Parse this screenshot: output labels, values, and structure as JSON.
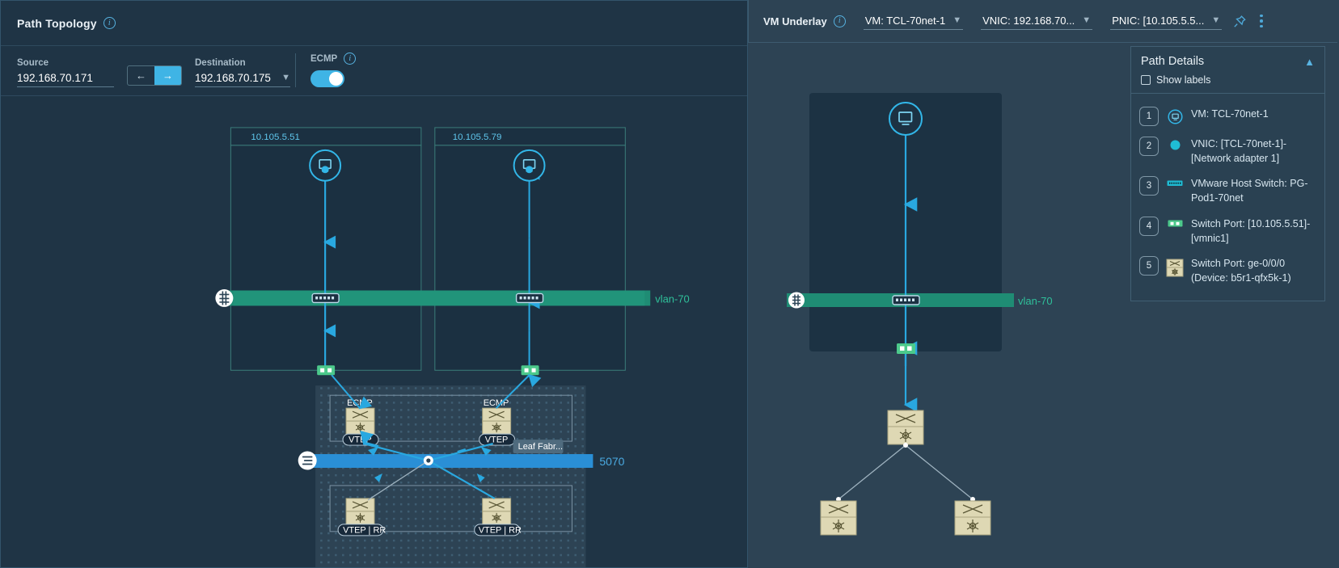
{
  "left_panel": {
    "title": "Path Topology",
    "info_icon": "info-icon",
    "source": {
      "label": "Source",
      "value": "192.168.70.171"
    },
    "direction": {
      "back_icon": "arrow-left-icon",
      "forward_icon": "arrow-right-icon"
    },
    "destination": {
      "label": "Destination",
      "value": "192.168.70.175",
      "caret_icon": "chevron-down-icon"
    },
    "ecmp": {
      "label": "ECMP",
      "enabled": true
    },
    "topology": {
      "hosts": [
        {
          "ip": "10.105.5.51",
          "vm_icon": "vm-monitor-icon",
          "nic_icon": "nic-port-icon"
        },
        {
          "ip": "10.105.5.79",
          "vm_icon": "vm-monitor-icon",
          "nic_icon": "nic-port-icon"
        }
      ],
      "vlan_band": {
        "label": "vlan-70",
        "color": "#1f8c74",
        "badge_icon": "vlan-badge-icon"
      },
      "vni_band": {
        "label": "5070",
        "color": "#2a8fd6",
        "badge_icon": "vni-badge-icon"
      },
      "leaf_group": {
        "tooltip": "Leaf Fabr...",
        "nodes": [
          {
            "top_label": "ECMP",
            "bottom_label": "VTEP",
            "switch_icon": "switch-icon"
          },
          {
            "top_label": "ECMP",
            "bottom_label": "VTEP",
            "switch_icon": "switch-icon"
          }
        ]
      },
      "spine_group": {
        "nodes": [
          {
            "bottom_label": "VTEP | RR",
            "switch_icon": "switch-icon"
          },
          {
            "bottom_label": "VTEP | RR",
            "switch_icon": "switch-icon"
          }
        ]
      }
    }
  },
  "right_panel": {
    "title": "VM Underlay",
    "info_icon": "info-icon",
    "selectors": [
      {
        "name": "vm-selector",
        "value": "VM: TCL-70net-1",
        "caret_icon": "chevron-down-icon"
      },
      {
        "name": "vnic-selector",
        "value": "VNIC: 192.168.70...",
        "caret_icon": "chevron-down-icon"
      },
      {
        "name": "pnic-selector",
        "value": "PNIC: [10.105.5.5...",
        "caret_icon": "chevron-down-icon"
      }
    ],
    "pin_icon": "pin-icon",
    "menu_icon": "kebab-menu-icon",
    "path_details": {
      "title": "Path Details",
      "collapse_icon": "chevron-up-icon",
      "show_labels": {
        "label": "Show labels",
        "checked": false
      },
      "items": [
        {
          "num": "1",
          "icon": "vm-circle-icon",
          "text": "VM: TCL-70net-1"
        },
        {
          "num": "2",
          "icon": "vnic-dot-icon",
          "text": "VNIC: [TCL-70net-1]-[Network adapter 1]"
        },
        {
          "num": "3",
          "icon": "host-switch-icon",
          "text": "VMware Host Switch: PG-Pod1-70net"
        },
        {
          "num": "4",
          "icon": "switch-port-icon",
          "text": "Switch Port: [10.105.5.51]-[vmnic1]"
        },
        {
          "num": "5",
          "icon": "physical-switch-icon",
          "text": "Switch Port: ge-0/0/0 (Device: b5r1-qfx5k-1)"
        }
      ]
    },
    "topology": {
      "vm_icon": "vm-monitor-icon",
      "nic_icon": "nic-port-icon",
      "vlan_band": {
        "label": "vlan-70",
        "color": "#1f8c74",
        "badge_icon": "vlan-badge-icon"
      },
      "switches": [
        {
          "name": "leaf-switch",
          "switch_icon": "switch-icon"
        },
        {
          "name": "spine-switch-left",
          "switch_icon": "switch-icon"
        },
        {
          "name": "spine-switch-right",
          "switch_icon": "switch-icon"
        }
      ]
    }
  },
  "colors": {
    "accent_blue": "#3fb4e5",
    "link_blue": "#29a8e0",
    "vlan_green": "#1f8c74",
    "vni_blue": "#2a8fd6",
    "panel_bg": "#1f3445",
    "outer_bg": "#2d4354",
    "switch_tan": "#ded8b4",
    "nic_green": "#4cc98b"
  }
}
